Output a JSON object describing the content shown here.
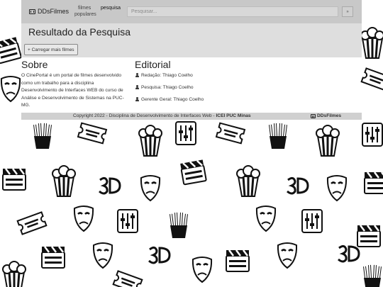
{
  "navbar": {
    "brand": "DDsFilmes",
    "links": {
      "filmes": "filmes",
      "populares": "populares",
      "pesquisa": "pesquisa"
    },
    "search_placeholder": "Pesquisar...",
    "search_button": "»"
  },
  "results": {
    "title": "Resultado da Pesquisa",
    "load_more": "+ Carregar mais filmes"
  },
  "sobre": {
    "title": "Sobre",
    "text": "O CinePortal é um portal de filmes desenvolvido como um trabalho para a disciplina Desenvolvimento de Interfaces WEB do curso de Análise e Desenvolvimento de Sistemas na PUC-MG."
  },
  "editorial": {
    "title": "Editorial",
    "items": [
      "Redação: Thiago Coelho",
      "Pesquisa: Thiago Coelho",
      "Gerente Geral: Thiago Coelho"
    ]
  },
  "footer": {
    "copyright": "Copyright 2022 - Disciplina de Desenvolvimento de Interfaces Web - ",
    "institution": "ICEI PUC Minas",
    "brand": "DDsFilmes"
  },
  "colors": {
    "navbar": "#c8c8c8",
    "panel": "#dedede",
    "footer": "#d0d0d0"
  },
  "icons": {
    "brand": "film-icon",
    "person": "user-icon"
  }
}
